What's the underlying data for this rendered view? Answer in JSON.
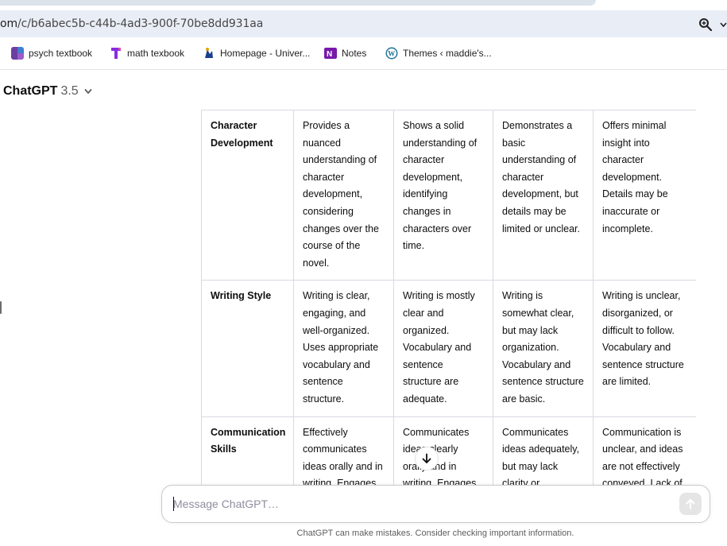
{
  "browser": {
    "url_prefix": "om",
    "url_rest": "/c/b6abec5b-c44b-4ad3-900f-70be8dd931aa",
    "bookmarks": [
      {
        "label": "psych textbook",
        "icon": "purple-square-icon",
        "color": "#6b3fa0"
      },
      {
        "label": "math texbook",
        "icon": "purple-t-icon",
        "color": "#8a2be2"
      },
      {
        "label": "Homepage - Univer...",
        "icon": "university-logo-icon",
        "color": "#1a3f8c"
      },
      {
        "label": "Notes",
        "icon": "onenote-icon",
        "color": "#7719aa"
      },
      {
        "label": "Themes ‹ maddie's...",
        "icon": "wordpress-icon",
        "color": "#21759b"
      }
    ]
  },
  "app": {
    "model_name": "ChatGPT",
    "model_version": "3.5"
  },
  "rubric": {
    "rows": [
      {
        "criterion": "Character Development",
        "cells": [
          "Provides a nuanced understanding of character development, considering changes over the course of the novel.",
          "Shows a solid understanding of character development, identifying changes in characters over time.",
          "Demonstrates a basic understanding of character development, but details may be limited or unclear.",
          "Offers minimal insight into character development. Details may be inaccurate or incomplete."
        ]
      },
      {
        "criterion": "Writing Style",
        "cells": [
          "Writing is clear, engaging, and well-organized. Uses appropriate vocabulary and sentence structure.",
          "Writing is mostly clear and organized. Vocabulary and sentence structure are adequate.",
          "Writing is somewhat clear, but may lack organization. Vocabulary and sentence structure are basic.",
          "Writing is unclear, disorganized, or difficult to follow. Vocabulary and sentence structure are limited."
        ]
      },
      {
        "criterion": "Communication Skills",
        "cells": [
          "Effectively communicates ideas orally and in writing. Engages",
          "Communicates ideas clearly orally and in writing. Engages",
          "Communicates ideas adequately, but may lack clarity or",
          "Communication is unclear, and ideas are not effectively conveyed. Lack of"
        ]
      }
    ]
  },
  "composer": {
    "placeholder": "Message ChatGPT…"
  },
  "footer": {
    "disclaimer": "ChatGPT can make mistakes. Consider checking important information."
  }
}
